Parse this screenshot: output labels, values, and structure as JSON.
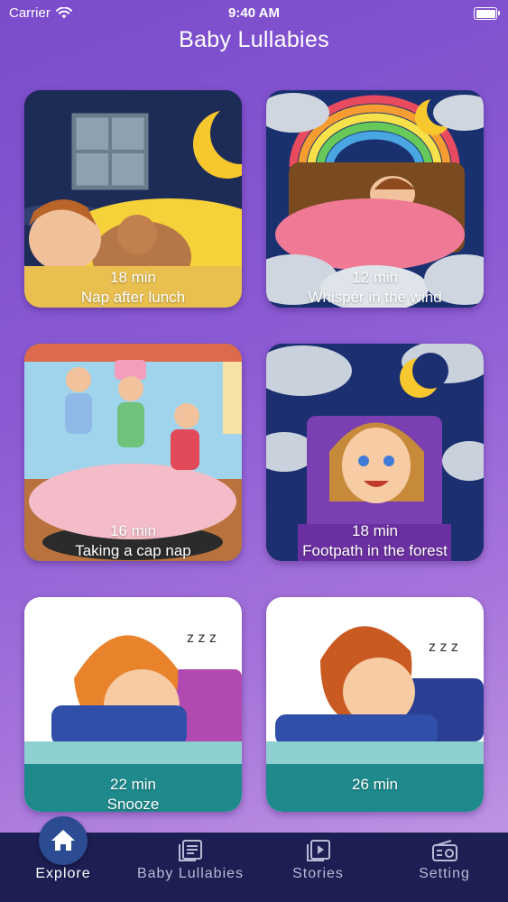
{
  "status_bar": {
    "carrier": "Carrier",
    "time": "9:40 AM"
  },
  "header": {
    "title": "Baby Lullabies"
  },
  "cards": [
    {
      "duration": "18 min",
      "title": "Nap after lunch"
    },
    {
      "duration": "12 min",
      "title": "Whisper in the wind"
    },
    {
      "duration": "16 min",
      "title": "Taking a cap nap"
    },
    {
      "duration": "18 min",
      "title": "Footpath in the forest"
    },
    {
      "duration": "22 min",
      "title": "Snooze"
    },
    {
      "duration": "26 min",
      "title": ""
    }
  ],
  "tabbar": {
    "tabs": [
      {
        "label": "Explore",
        "icon": "home-icon",
        "active": true
      },
      {
        "label": "Baby Lullabies",
        "icon": "library-icon",
        "active": false
      },
      {
        "label": "Stories",
        "icon": "play-icon",
        "active": false
      },
      {
        "label": "Setting",
        "icon": "radio-icon",
        "active": false
      }
    ]
  },
  "colors": {
    "tabbar_bg": "#1d1e52",
    "active_tab_bubble": "#2b4c92",
    "bg_gradient_start": "#7a4ccc",
    "bg_gradient_end": "#c59be6"
  }
}
